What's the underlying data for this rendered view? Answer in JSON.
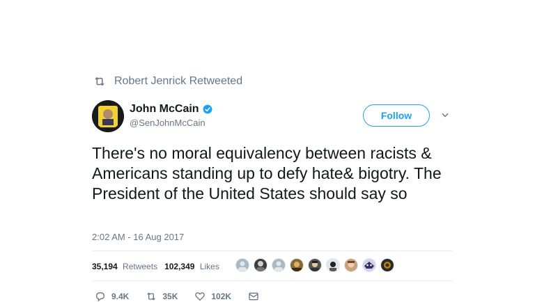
{
  "retweet_context": {
    "label": "Robert Jenrick Retweeted",
    "icon": "retweet-icon"
  },
  "author": {
    "name": "John McCain",
    "handle": "@SenJohnMcCain",
    "verified": true,
    "verified_color": "#1da1f2"
  },
  "follow_button": {
    "label": "Follow"
  },
  "tweet": {
    "text": "There's no moral equivalency between racists & Americans standing up to defy hate& bigotry. The President of the United States should say so",
    "timestamp": "2:02 AM - 16 Aug 2017"
  },
  "stats": {
    "retweets_count": "35,194",
    "retweets_label": "Retweets",
    "likes_count": "102,349",
    "likes_label": "Likes"
  },
  "actions": {
    "reply_count": "9.4K",
    "retweet_count": "35K",
    "like_count": "102K"
  },
  "colors": {
    "accent": "#1da1f2",
    "secondary_text": "#657786",
    "divider": "#e6ecf0"
  }
}
